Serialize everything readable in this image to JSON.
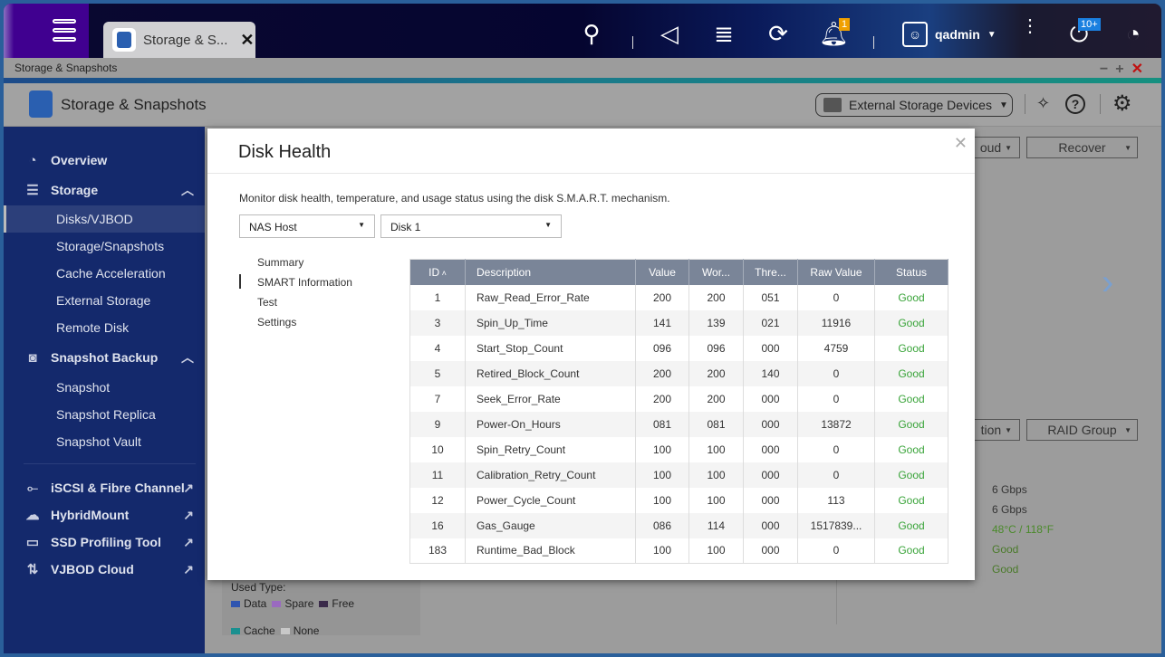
{
  "topbar": {
    "tab_label": "Storage & S...",
    "user": "qadmin",
    "notification_count": "1",
    "update_count": "10+"
  },
  "window": {
    "title": "Storage & Snapshots"
  },
  "app": {
    "title": "Storage & Snapshots",
    "external_devices": "External Storage Devices"
  },
  "sidebar": {
    "overview": "Overview",
    "storage": "Storage",
    "storage_items": [
      "Disks/VJBOD",
      "Storage/Snapshots",
      "Cache Acceleration",
      "External Storage",
      "Remote Disk"
    ],
    "snapshot_backup": "Snapshot Backup",
    "snapshot_items": [
      "Snapshot",
      "Snapshot Replica",
      "Snapshot Vault"
    ],
    "links": [
      "iSCSI & Fibre Channel",
      "HybridMount",
      "SSD Profiling Tool",
      "VJBOD Cloud"
    ]
  },
  "background": {
    "btn_cloud": "oud",
    "btn_recover": "Recover",
    "btn_tion": "tion",
    "btn_raid": "RAID Group",
    "values": [
      "6 Gbps",
      "6 Gbps",
      "48°C / 118°F",
      "Good",
      "Good"
    ],
    "used_type_label": "Used Type:",
    "legend": [
      {
        "label": "Data",
        "color": "#2f55b0"
      },
      {
        "label": "Spare",
        "color": "#9a6ac0"
      },
      {
        "label": "Free",
        "color": "#3a2a4a"
      },
      {
        "label": "Cache",
        "color": "#1a9090"
      },
      {
        "label": "None",
        "color": "#c8c8c8"
      }
    ]
  },
  "modal": {
    "title": "Disk Health",
    "description": "Monitor disk health, temperature, and usage status using the disk S.M.A.R.T. mechanism.",
    "host_select": "NAS Host",
    "disk_select": "Disk 1",
    "nav": [
      "Summary",
      "SMART Information",
      "Test",
      "Settings"
    ],
    "active_nav": "SMART Information",
    "columns": [
      "ID",
      "Description",
      "Value",
      "Wor...",
      "Thre...",
      "Raw Value",
      "Status"
    ],
    "rows": [
      [
        "1",
        "Raw_Read_Error_Rate",
        "200",
        "200",
        "051",
        "0",
        "Good"
      ],
      [
        "3",
        "Spin_Up_Time",
        "141",
        "139",
        "021",
        "11916",
        "Good"
      ],
      [
        "4",
        "Start_Stop_Count",
        "096",
        "096",
        "000",
        "4759",
        "Good"
      ],
      [
        "5",
        "Retired_Block_Count",
        "200",
        "200",
        "140",
        "0",
        "Good"
      ],
      [
        "7",
        "Seek_Error_Rate",
        "200",
        "200",
        "000",
        "0",
        "Good"
      ],
      [
        "9",
        "Power-On_Hours",
        "081",
        "081",
        "000",
        "13872",
        "Good"
      ],
      [
        "10",
        "Spin_Retry_Count",
        "100",
        "100",
        "000",
        "0",
        "Good"
      ],
      [
        "11",
        "Calibration_Retry_Count",
        "100",
        "100",
        "000",
        "0",
        "Good"
      ],
      [
        "12",
        "Power_Cycle_Count",
        "100",
        "100",
        "000",
        "113",
        "Good"
      ],
      [
        "16",
        "Gas_Gauge",
        "086",
        "114",
        "000",
        "1517839...",
        "Good"
      ],
      [
        "183",
        "Runtime_Bad_Block",
        "100",
        "100",
        "000",
        "0",
        "Good"
      ]
    ],
    "status_color": "#3aa43a"
  }
}
